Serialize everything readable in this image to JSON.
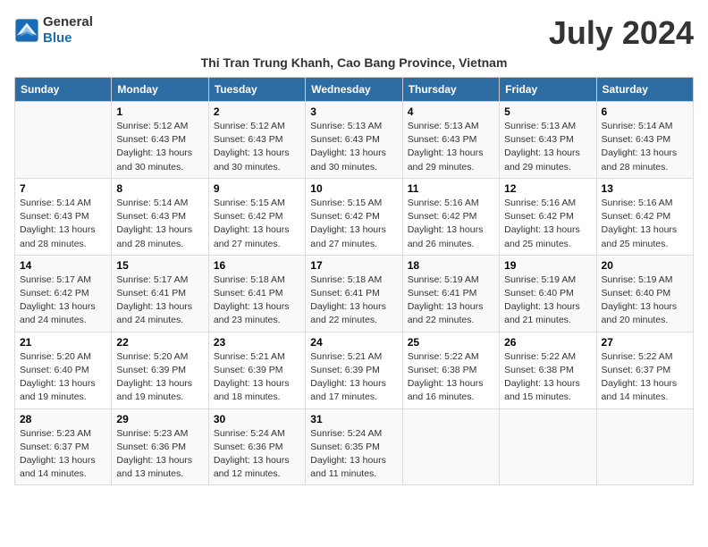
{
  "logo": {
    "line1": "General",
    "line2": "Blue"
  },
  "title": "July 2024",
  "subtitle": "Thi Tran Trung Khanh, Cao Bang Province, Vietnam",
  "days_header": [
    "Sunday",
    "Monday",
    "Tuesday",
    "Wednesday",
    "Thursday",
    "Friday",
    "Saturday"
  ],
  "weeks": [
    [
      {
        "day": "",
        "content": ""
      },
      {
        "day": "1",
        "content": "Sunrise: 5:12 AM\nSunset: 6:43 PM\nDaylight: 13 hours\nand 30 minutes."
      },
      {
        "day": "2",
        "content": "Sunrise: 5:12 AM\nSunset: 6:43 PM\nDaylight: 13 hours\nand 30 minutes."
      },
      {
        "day": "3",
        "content": "Sunrise: 5:13 AM\nSunset: 6:43 PM\nDaylight: 13 hours\nand 30 minutes."
      },
      {
        "day": "4",
        "content": "Sunrise: 5:13 AM\nSunset: 6:43 PM\nDaylight: 13 hours\nand 29 minutes."
      },
      {
        "day": "5",
        "content": "Sunrise: 5:13 AM\nSunset: 6:43 PM\nDaylight: 13 hours\nand 29 minutes."
      },
      {
        "day": "6",
        "content": "Sunrise: 5:14 AM\nSunset: 6:43 PM\nDaylight: 13 hours\nand 28 minutes."
      }
    ],
    [
      {
        "day": "7",
        "content": "Sunrise: 5:14 AM\nSunset: 6:43 PM\nDaylight: 13 hours\nand 28 minutes."
      },
      {
        "day": "8",
        "content": "Sunrise: 5:14 AM\nSunset: 6:43 PM\nDaylight: 13 hours\nand 28 minutes."
      },
      {
        "day": "9",
        "content": "Sunrise: 5:15 AM\nSunset: 6:42 PM\nDaylight: 13 hours\nand 27 minutes."
      },
      {
        "day": "10",
        "content": "Sunrise: 5:15 AM\nSunset: 6:42 PM\nDaylight: 13 hours\nand 27 minutes."
      },
      {
        "day": "11",
        "content": "Sunrise: 5:16 AM\nSunset: 6:42 PM\nDaylight: 13 hours\nand 26 minutes."
      },
      {
        "day": "12",
        "content": "Sunrise: 5:16 AM\nSunset: 6:42 PM\nDaylight: 13 hours\nand 25 minutes."
      },
      {
        "day": "13",
        "content": "Sunrise: 5:16 AM\nSunset: 6:42 PM\nDaylight: 13 hours\nand 25 minutes."
      }
    ],
    [
      {
        "day": "14",
        "content": "Sunrise: 5:17 AM\nSunset: 6:42 PM\nDaylight: 13 hours\nand 24 minutes."
      },
      {
        "day": "15",
        "content": "Sunrise: 5:17 AM\nSunset: 6:41 PM\nDaylight: 13 hours\nand 24 minutes."
      },
      {
        "day": "16",
        "content": "Sunrise: 5:18 AM\nSunset: 6:41 PM\nDaylight: 13 hours\nand 23 minutes."
      },
      {
        "day": "17",
        "content": "Sunrise: 5:18 AM\nSunset: 6:41 PM\nDaylight: 13 hours\nand 22 minutes."
      },
      {
        "day": "18",
        "content": "Sunrise: 5:19 AM\nSunset: 6:41 PM\nDaylight: 13 hours\nand 22 minutes."
      },
      {
        "day": "19",
        "content": "Sunrise: 5:19 AM\nSunset: 6:40 PM\nDaylight: 13 hours\nand 21 minutes."
      },
      {
        "day": "20",
        "content": "Sunrise: 5:19 AM\nSunset: 6:40 PM\nDaylight: 13 hours\nand 20 minutes."
      }
    ],
    [
      {
        "day": "21",
        "content": "Sunrise: 5:20 AM\nSunset: 6:40 PM\nDaylight: 13 hours\nand 19 minutes."
      },
      {
        "day": "22",
        "content": "Sunrise: 5:20 AM\nSunset: 6:39 PM\nDaylight: 13 hours\nand 19 minutes."
      },
      {
        "day": "23",
        "content": "Sunrise: 5:21 AM\nSunset: 6:39 PM\nDaylight: 13 hours\nand 18 minutes."
      },
      {
        "day": "24",
        "content": "Sunrise: 5:21 AM\nSunset: 6:39 PM\nDaylight: 13 hours\nand 17 minutes."
      },
      {
        "day": "25",
        "content": "Sunrise: 5:22 AM\nSunset: 6:38 PM\nDaylight: 13 hours\nand 16 minutes."
      },
      {
        "day": "26",
        "content": "Sunrise: 5:22 AM\nSunset: 6:38 PM\nDaylight: 13 hours\nand 15 minutes."
      },
      {
        "day": "27",
        "content": "Sunrise: 5:22 AM\nSunset: 6:37 PM\nDaylight: 13 hours\nand 14 minutes."
      }
    ],
    [
      {
        "day": "28",
        "content": "Sunrise: 5:23 AM\nSunset: 6:37 PM\nDaylight: 13 hours\nand 14 minutes."
      },
      {
        "day": "29",
        "content": "Sunrise: 5:23 AM\nSunset: 6:36 PM\nDaylight: 13 hours\nand 13 minutes."
      },
      {
        "day": "30",
        "content": "Sunrise: 5:24 AM\nSunset: 6:36 PM\nDaylight: 13 hours\nand 12 minutes."
      },
      {
        "day": "31",
        "content": "Sunrise: 5:24 AM\nSunset: 6:35 PM\nDaylight: 13 hours\nand 11 minutes."
      },
      {
        "day": "",
        "content": ""
      },
      {
        "day": "",
        "content": ""
      },
      {
        "day": "",
        "content": ""
      }
    ]
  ]
}
